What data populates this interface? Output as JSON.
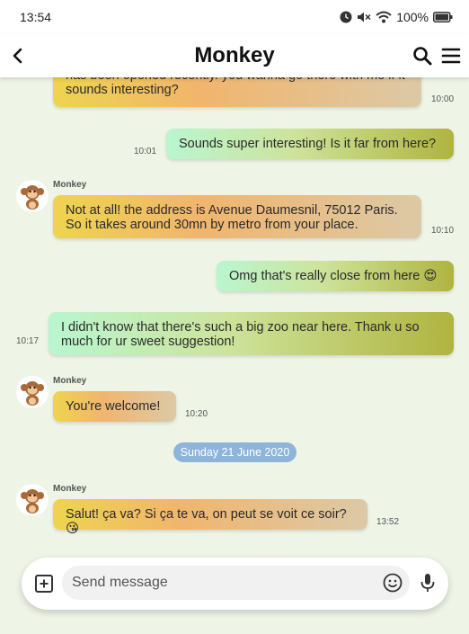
{
  "status_bar": {
    "time": "13:54",
    "battery": "100%"
  },
  "header": {
    "title": "Monkey"
  },
  "messages": [
    {
      "direction": "received",
      "text": "has been opened recently. you wanna go there with me if it sounds interesting?",
      "time": "10:00"
    },
    {
      "direction": "sent",
      "text": "Sounds super interesting! Is it far from here?",
      "time": "10:01"
    },
    {
      "direction": "received",
      "sender": "Monkey",
      "text": "Not at all! the address is Avenue Daumesnil, 75012 Paris. So it takes around 30mn by metro from your place.",
      "time": "10:10"
    },
    {
      "direction": "sent",
      "text": "Omg that's really close from here 😍",
      "time": ""
    },
    {
      "direction": "sent",
      "text": "I didn't know that there's such a big zoo near here. Thank u so much for ur sweet suggestion!",
      "time": "10:17"
    },
    {
      "direction": "received",
      "sender": "Monkey",
      "text": "You're welcome!",
      "time": "10:20"
    },
    {
      "direction": "received",
      "sender": "Monkey",
      "text": "Salut! ça va? Si ça te va, on peut se voit ce soir? 😘",
      "time": "13:52"
    }
  ],
  "date_separator": "Sunday 21 June 2020",
  "composer": {
    "placeholder": "Send message"
  },
  "icons": {
    "back": "chevron-left-icon",
    "search": "search-icon",
    "menu": "hamburger-menu-icon",
    "add": "add-square-icon",
    "emoji": "smiley-icon",
    "mic": "microphone-icon",
    "avatar": "monkey-avatar-icon"
  },
  "colors": {
    "background": "#eef4e6",
    "date_chip": "#8fb4d9",
    "received_start": "#eed44e",
    "sent_start": "#b9f6d0"
  }
}
